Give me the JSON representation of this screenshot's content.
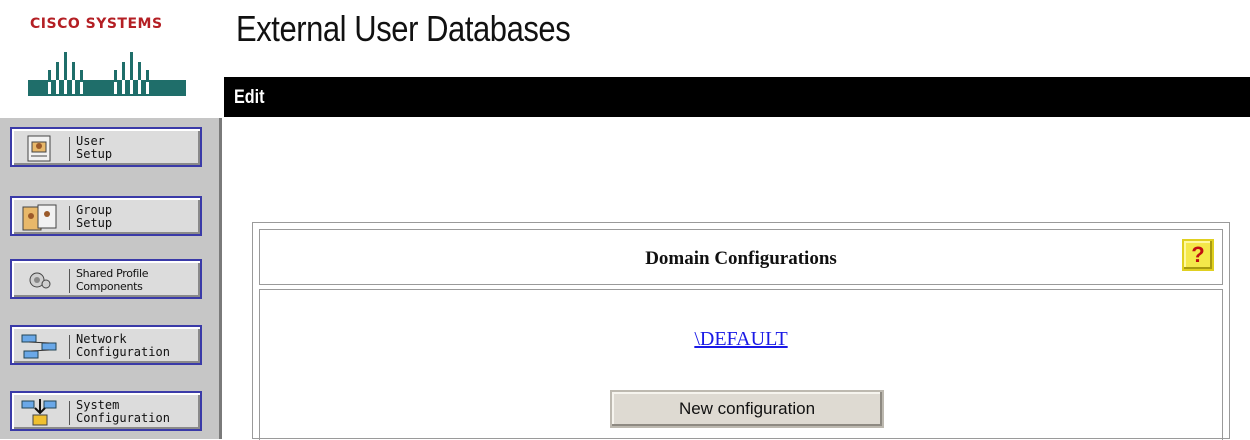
{
  "logo": {
    "text": "Cisco Systems"
  },
  "page": {
    "title": "External User Databases"
  },
  "edit_bar": {
    "label": "Edit"
  },
  "nav": {
    "items": [
      {
        "label": "User\nSetup",
        "icon": "user-setup-icon"
      },
      {
        "label": "Group\nSetup",
        "icon": "group-setup-icon"
      },
      {
        "label": "Shared Profile\nComponents",
        "icon": "shared-profile-icon"
      },
      {
        "label": "Network\nConfiguration",
        "icon": "network-config-icon"
      },
      {
        "label": "System\nConfiguration",
        "icon": "system-config-icon"
      }
    ]
  },
  "panel": {
    "title": "Domain Configurations",
    "help_label": "?",
    "default_link": "\\DEFAULT",
    "new_config_label": "New configuration"
  },
  "colors": {
    "brand_red": "#b41f24",
    "brand_teal": "#1f6e6a",
    "nav_border": "#3a3aa8",
    "link_blue": "#1a1ae6",
    "help_yellow": "#f4e84a"
  }
}
